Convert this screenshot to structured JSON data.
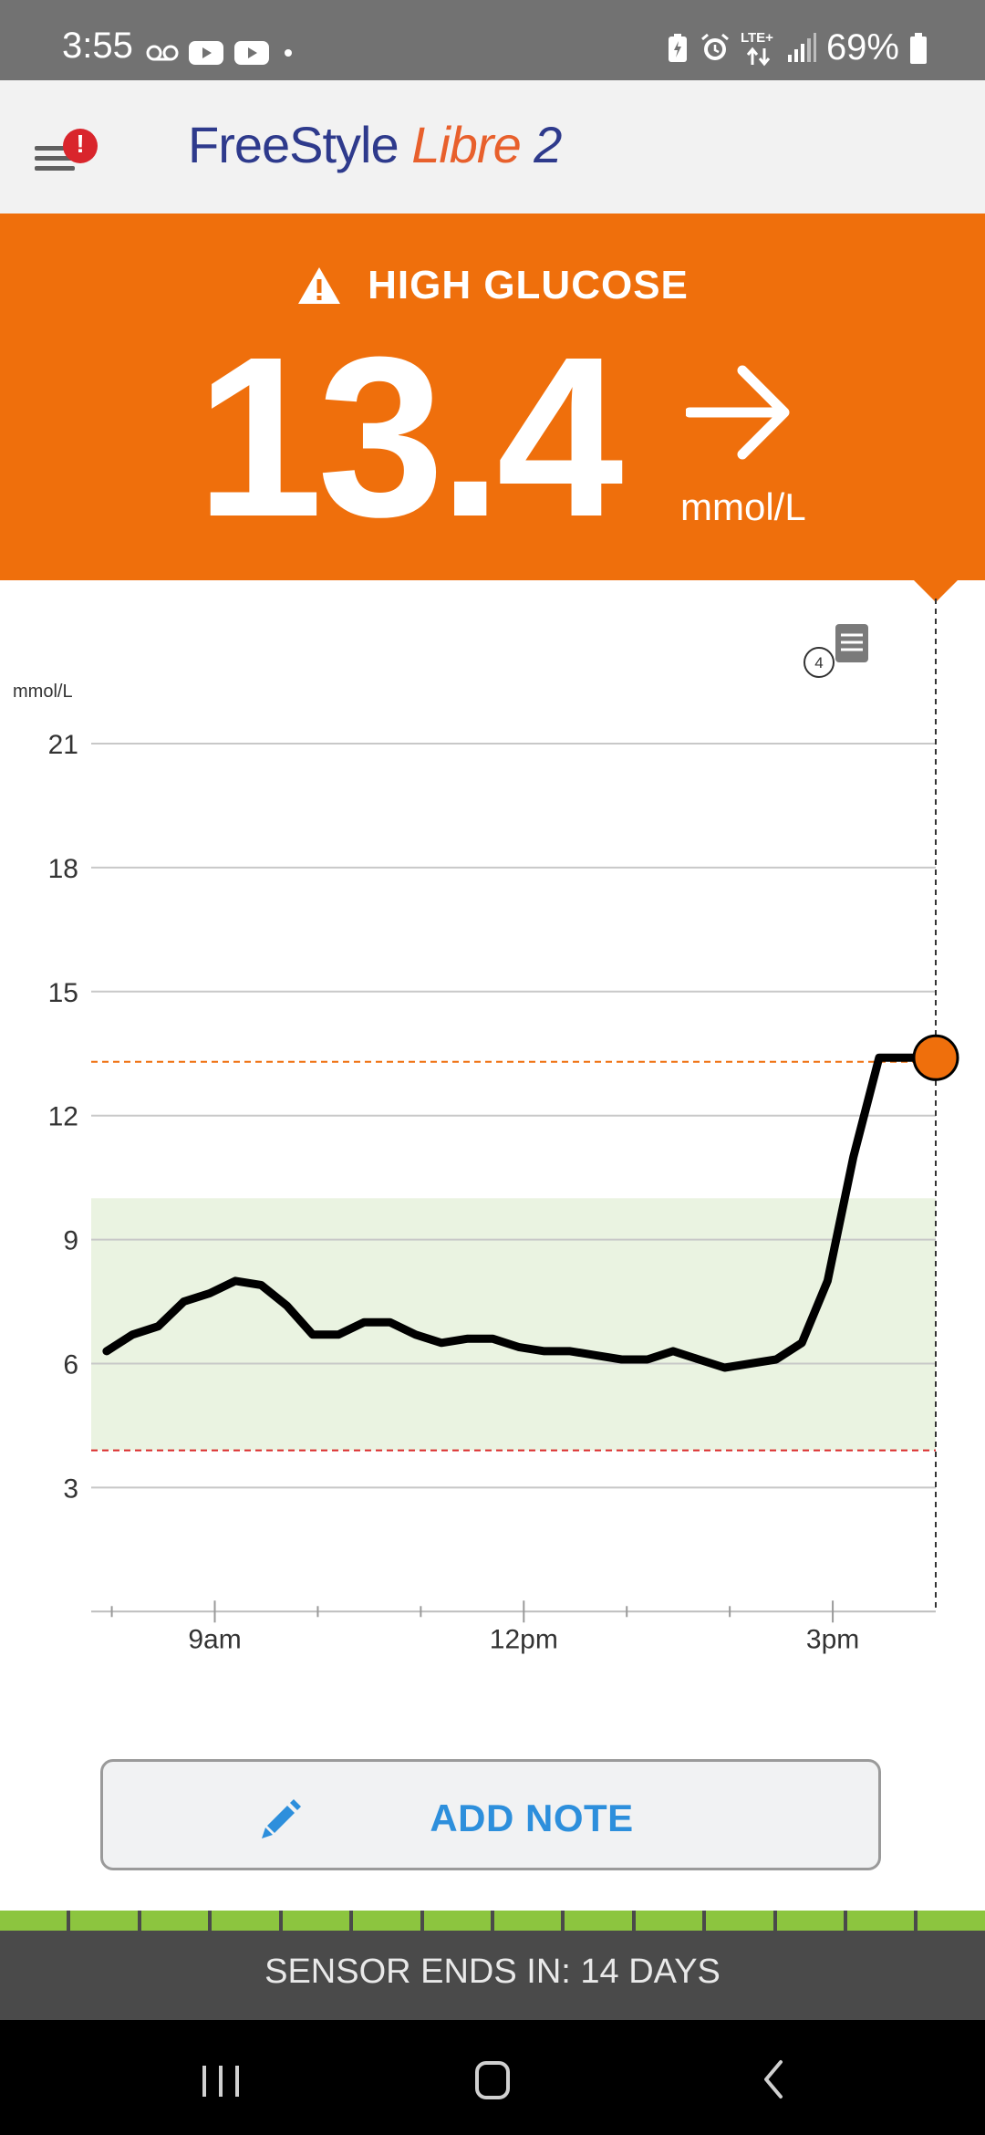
{
  "status_bar": {
    "time": "3:55",
    "battery_percent": "69%",
    "network": "LTE+",
    "icons": [
      "voicemail-icon",
      "youtube-icon",
      "youtube-icon",
      "dot-icon",
      "battery-saver-icon",
      "alarm-icon",
      "lte-icon",
      "signal-icon",
      "battery-icon"
    ]
  },
  "header": {
    "brand_part1": "FreeStyle",
    "brand_part2": "Libre",
    "brand_part3": "2",
    "menu_alert": "!"
  },
  "alert": {
    "title": "HIGH GLUCOSE",
    "value": "13.4",
    "unit": "mmol/L",
    "trend": "steady-arrow"
  },
  "notes": {
    "count": "4"
  },
  "chart_data": {
    "type": "line",
    "ylabel": "mmol/L",
    "ylim": [
      0,
      21
    ],
    "yticks": [
      "21",
      "18",
      "15",
      "12",
      "9",
      "6",
      "3"
    ],
    "xticks": [
      "9am",
      "12pm",
      "3pm"
    ],
    "target_range": [
      3.9,
      10.0
    ],
    "high_threshold_line": 13.3,
    "low_threshold_line": 3.9,
    "current_value": 13.4,
    "series": [
      {
        "x": [
          7.95,
          8.2,
          8.45,
          8.7,
          8.95,
          9.2,
          9.45,
          9.7,
          9.95,
          10.2,
          10.45,
          10.7,
          10.95,
          11.2,
          11.45,
          11.7,
          11.95,
          12.2,
          12.45,
          12.7,
          12.95,
          13.2,
          13.45,
          13.7,
          13.95,
          14.2,
          14.45,
          14.7,
          14.95,
          15.2,
          15.45,
          15.7,
          15.95
        ],
        "y": [
          6.3,
          6.7,
          6.9,
          7.5,
          7.7,
          8.0,
          7.9,
          7.4,
          6.7,
          6.7,
          7.0,
          7.0,
          6.7,
          6.5,
          6.6,
          6.6,
          6.4,
          6.3,
          6.3,
          6.2,
          6.1,
          6.1,
          6.3,
          6.1,
          5.9,
          6.0,
          6.1,
          6.5,
          8.0,
          11.0,
          13.4,
          13.4,
          13.4
        ]
      }
    ]
  },
  "add_note": {
    "label": "ADD NOTE"
  },
  "sensor": {
    "text": "SENSOR ENDS IN: 14 DAYS",
    "segments_filled": 14,
    "segments_total": 14
  },
  "colors": {
    "alert_orange": "#ef6f0c",
    "target_green": "#eaf3e1",
    "low_red": "#d92a2a",
    "progress_green": "#8cc53f",
    "brand_blue": "#2e3a8c",
    "brand_orange": "#e8602c",
    "link_blue": "#2d8fdc"
  }
}
